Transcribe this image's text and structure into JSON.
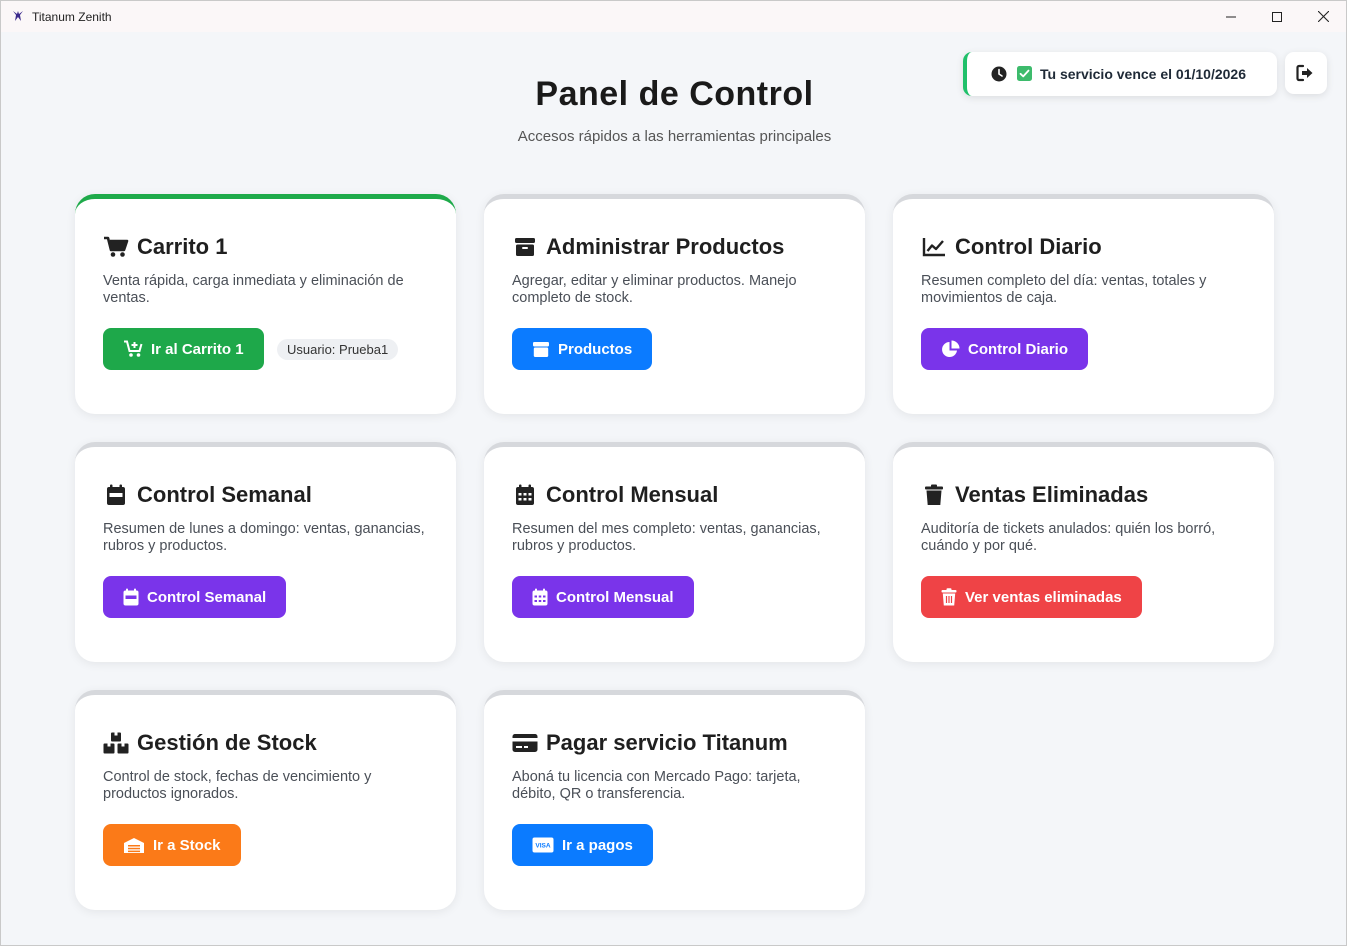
{
  "window": {
    "title": "Titanum Zenith",
    "controls": {
      "minimize": "minimize-icon",
      "maximize": "maximize-icon",
      "close": "close-icon"
    }
  },
  "service": {
    "text": "Tu servicio vence el 01/10/2026",
    "status_color": "#20c06a"
  },
  "header": {
    "title": "Panel de Control",
    "subtitle": "Accesos rápidos a las herramientas principales"
  },
  "cards": [
    {
      "title": "Carrito 1",
      "description": "Venta rápida, carga inmediata y eliminación de ventas.",
      "button_label": "Ir al Carrito 1",
      "button_color": "#1ea84a",
      "user_label": "Usuario: Prueba1",
      "active": true
    },
    {
      "title": "Administrar Productos",
      "description": "Agregar, editar y eliminar productos. Manejo completo de stock.",
      "button_label": "Productos",
      "button_color": "#0b7bff"
    },
    {
      "title": "Control Diario",
      "description": "Resumen completo del día: ventas, totales y movimientos de caja.",
      "button_label": "Control Diario",
      "button_color": "#7a34ea"
    },
    {
      "title": "Control Semanal",
      "description": "Resumen de lunes a domingo: ventas, ganancias, rubros y productos.",
      "button_label": "Control Semanal",
      "button_color": "#7a34ea"
    },
    {
      "title": "Control Mensual",
      "description": "Resumen del mes completo: ventas, ganancias, rubros y productos.",
      "button_label": "Control Mensual",
      "button_color": "#7a34ea"
    },
    {
      "title": "Ventas Eliminadas",
      "description": "Auditoría de tickets anulados: quién los borró, cuándo y por qué.",
      "button_label": "Ver ventas eliminadas",
      "button_color": "#ef4346"
    },
    {
      "title": "Gestión de Stock",
      "description": "Control de stock, fechas de vencimiento y productos ignorados.",
      "button_label": "Ir a Stock",
      "button_color": "#fb7a18"
    },
    {
      "title": "Pagar servicio Titanum",
      "description": "Aboná tu licencia con Mercado Pago: tarjeta, débito, QR o transferencia.",
      "button_label": "Ir a pagos",
      "button_color": "#0b7bff"
    }
  ]
}
